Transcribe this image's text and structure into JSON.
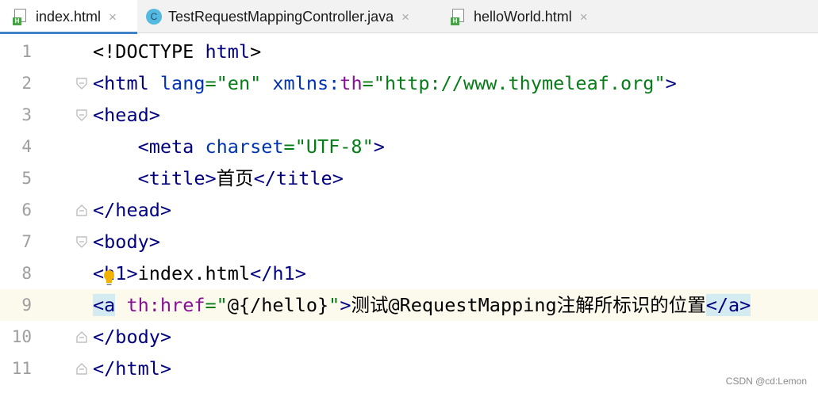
{
  "tabs": [
    {
      "label": "index.html",
      "icon": "html-file-icon",
      "active": true,
      "close": "×"
    },
    {
      "label": "TestRequestMappingController.java",
      "icon": "java-class-icon",
      "icon_letter": "C",
      "active": false,
      "close": "×"
    },
    {
      "label": "helloWorld.html",
      "icon": "html-file-icon",
      "active": false,
      "close": "×"
    }
  ],
  "file_badge": "H",
  "editor": {
    "current_line": 9,
    "lines": [
      {
        "number": "1",
        "tokens": [
          "<!DOCTYPE",
          " html",
          ">"
        ]
      },
      {
        "number": "2",
        "tokens": [
          "<html",
          " lang",
          "=",
          "\"en\"",
          " xmlns:",
          "th",
          "=",
          "\"http://www.thymeleaf.org\"",
          ">"
        ]
      },
      {
        "number": "3",
        "tokens": [
          "<head",
          ">"
        ]
      },
      {
        "number": "4",
        "tokens": [
          "    <meta",
          " charset",
          "=",
          "\"UTF-8\"",
          ">"
        ]
      },
      {
        "number": "5",
        "tokens": [
          "    <title",
          ">",
          "首页",
          "</title",
          ">"
        ]
      },
      {
        "number": "6",
        "tokens": [
          "</head",
          ">"
        ]
      },
      {
        "number": "7",
        "tokens": [
          "<body",
          ">"
        ]
      },
      {
        "number": "8",
        "tokens": [
          "<h1",
          ">",
          "index.html",
          "</h1",
          ">"
        ]
      },
      {
        "number": "9",
        "tokens": [
          "<a",
          " th",
          ":href",
          "=",
          "\"",
          "@{/hello}",
          "\"",
          ">",
          "测试@RequestMapping注解所标识的位置",
          "</a",
          ">"
        ]
      },
      {
        "number": "10",
        "tokens": [
          "</body",
          ">"
        ]
      },
      {
        "number": "11",
        "tokens": [
          "</html",
          ">"
        ]
      }
    ]
  },
  "colors": {
    "tag": "#000080",
    "attribute": "#0033b3",
    "thymeleaf_prefix": "#871094",
    "string": "#067d17",
    "current_line_bg": "#fcfaed",
    "tag_match_bg": "#d4ebf2",
    "active_tab_underline": "#4083c9"
  },
  "watermark": "CSDN @cd:Lemon"
}
